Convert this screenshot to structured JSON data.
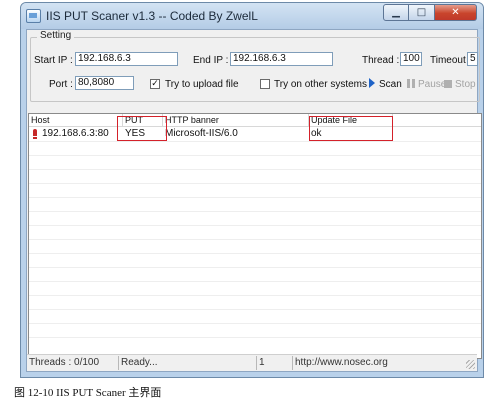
{
  "window": {
    "title": "IIS PUT Scaner v1.3 -- Coded By ZwelL",
    "minimize_glyph": "▁",
    "maximize_glyph": "□",
    "close_glyph": "✕"
  },
  "setting": {
    "legend": "Setting",
    "start_ip_label": "Start IP :",
    "start_ip_value": "192.168.6.3",
    "end_ip_label": "End IP :",
    "end_ip_value": "192.168.6.3",
    "thread_label": "Thread :",
    "thread_value": "100",
    "timeout_label": "Timeout :",
    "timeout_value": "5",
    "port_label": "Port :",
    "port_value": "80,8080",
    "try_upload_label": "Try to upload file",
    "try_upload_checked": true,
    "try_upload_mark": "✓",
    "try_other_label": "Try on other systems",
    "try_other_checked": false,
    "scan_label": "Scan",
    "pause_label": "Pause",
    "stop_label": "Stop"
  },
  "list": {
    "columns": [
      "Host",
      "PUT",
      "HTTP banner",
      "Update File"
    ],
    "rows": [
      {
        "host": "192.168.6.3:80",
        "put": "YES",
        "banner": "Microsoft-IIS/6.0",
        "update_file": "ok"
      }
    ]
  },
  "status": {
    "threads": "Threads : 0/100",
    "state": "Ready...",
    "count": "1",
    "url": "http://www.nosec.org"
  },
  "caption": "图 12-10    IIS PUT Scaner 主界面",
  "colors": {
    "highlight_box": "#d4212a",
    "scan_arrow": "#1f63c7",
    "vuln_icon": "#c62828"
  }
}
